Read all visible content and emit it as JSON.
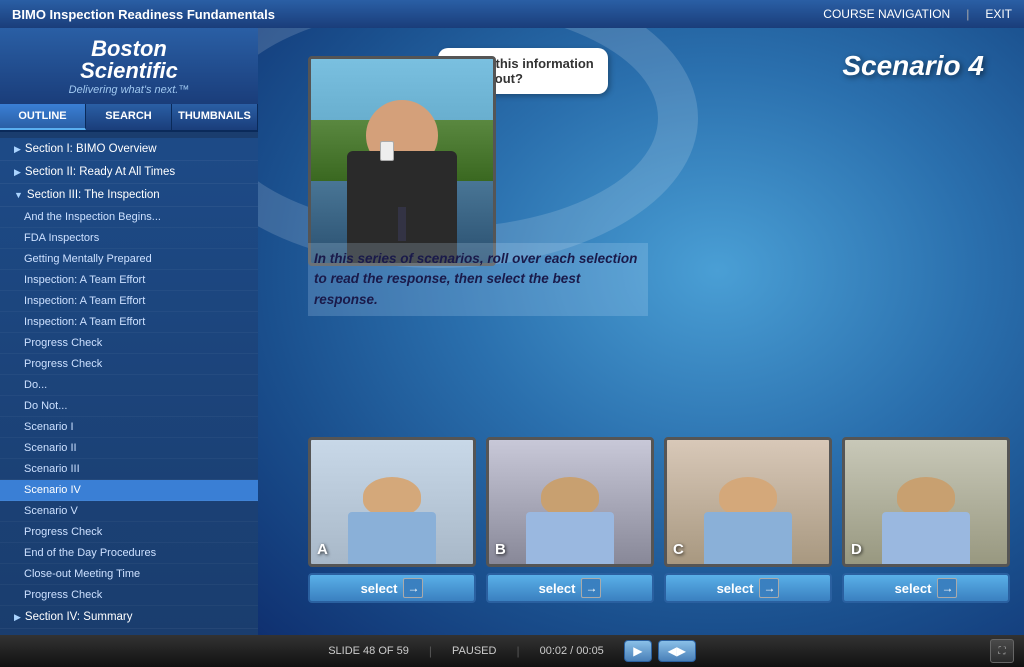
{
  "topBar": {
    "title": "BIMO Inspection Readiness Fundamentals",
    "nav": {
      "courseNav": "COURSE NAVIGATION",
      "exit": "EXIT"
    }
  },
  "sidebar": {
    "logo": {
      "line1": "Boston",
      "line2": "Scientific",
      "tagline": "Delivering what's next.™"
    },
    "tabs": [
      {
        "id": "outline",
        "label": "OUTLINE",
        "active": true
      },
      {
        "id": "search",
        "label": "SEARCH",
        "active": false
      },
      {
        "id": "thumbnails",
        "label": "THUMBNAILS",
        "active": false
      }
    ],
    "sections": [
      {
        "type": "section",
        "label": "Section I: BIMO Overview",
        "collapsed": true
      },
      {
        "type": "section",
        "label": "Section II: Ready At All Times",
        "collapsed": true
      },
      {
        "type": "section",
        "label": "Section III: The Inspection",
        "collapsed": false
      },
      {
        "type": "item",
        "label": "And the Inspection Begins..."
      },
      {
        "type": "item",
        "label": "FDA Inspectors"
      },
      {
        "type": "item",
        "label": "Getting Mentally Prepared"
      },
      {
        "type": "item",
        "label": "Inspection: A Team Effort"
      },
      {
        "type": "item",
        "label": "Inspection: A Team Effort"
      },
      {
        "type": "item",
        "label": "Inspection: A Team Effort"
      },
      {
        "type": "item",
        "label": "Progress Check"
      },
      {
        "type": "item",
        "label": "Progress Check"
      },
      {
        "type": "item",
        "label": "Do..."
      },
      {
        "type": "item",
        "label": "Do Not..."
      },
      {
        "type": "item",
        "label": "Scenario I"
      },
      {
        "type": "item",
        "label": "Scenario II"
      },
      {
        "type": "item",
        "label": "Scenario III"
      },
      {
        "type": "item",
        "label": "Scenario IV",
        "active": true
      },
      {
        "type": "item",
        "label": "Scenario V"
      },
      {
        "type": "item",
        "label": "Progress Check"
      },
      {
        "type": "item",
        "label": "End of the Day Procedures"
      },
      {
        "type": "item",
        "label": "Close-out Meeting Time"
      },
      {
        "type": "item",
        "label": "Progress Check"
      },
      {
        "type": "section",
        "label": "Section IV: Summary",
        "collapsed": true
      }
    ]
  },
  "content": {
    "scenarioTitle": "Scenario 4",
    "speechBubble": "Why is this information whited out?",
    "instructionText": "In this series of scenarios, roll over each selection to read the response, then select the best response.",
    "options": [
      {
        "id": "A",
        "label": "A",
        "selectLabel": "select"
      },
      {
        "id": "B",
        "label": "B",
        "selectLabel": "select"
      },
      {
        "id": "C",
        "label": "C",
        "selectLabel": "select"
      },
      {
        "id": "D",
        "label": "D",
        "selectLabel": "select"
      }
    ]
  },
  "bottomBar": {
    "slideInfo": "SLIDE 48 OF 59",
    "status": "PAUSED",
    "time": "00:02 / 00:05"
  }
}
